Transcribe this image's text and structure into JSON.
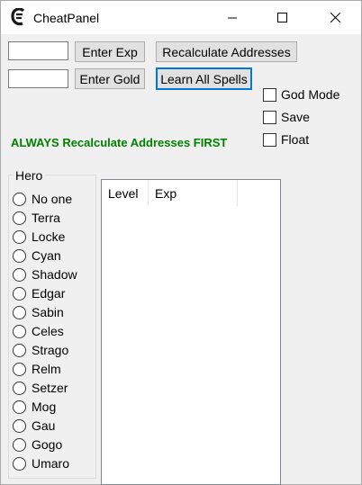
{
  "window": {
    "title": "CheatPanel",
    "app_icon": "cheat-engine-icon",
    "controls": [
      "minimize-icon",
      "maximize-icon",
      "close-icon"
    ]
  },
  "inputs": {
    "exp_value": "",
    "gold_value": ""
  },
  "buttons": {
    "enter_exp": "Enter Exp",
    "recalculate": "Recalculate Addresses",
    "enter_gold": "Enter Gold",
    "learn_spells": "Learn All Spells"
  },
  "checkboxes": [
    {
      "label": "God Mode",
      "checked": false
    },
    {
      "label": "Save",
      "checked": false
    },
    {
      "label": "Float",
      "checked": false
    }
  ],
  "warning": {
    "text": "ALWAYS Recalculate Addresses FIRST",
    "color": "#008000"
  },
  "hero": {
    "title": "Hero",
    "options": [
      "No one",
      "Terra",
      "Locke",
      "Cyan",
      "Shadow",
      "Edgar",
      "Sabin",
      "Celes",
      "Strago",
      "Relm",
      "Setzer",
      "Mog",
      "Gau",
      "Gogo",
      "Umaro"
    ]
  },
  "listview": {
    "columns": [
      "Level",
      "Exp"
    ]
  },
  "colors": {
    "focus_border": "#0078d7",
    "titlebar": "#ffffff",
    "background": "#f0f0f0"
  }
}
